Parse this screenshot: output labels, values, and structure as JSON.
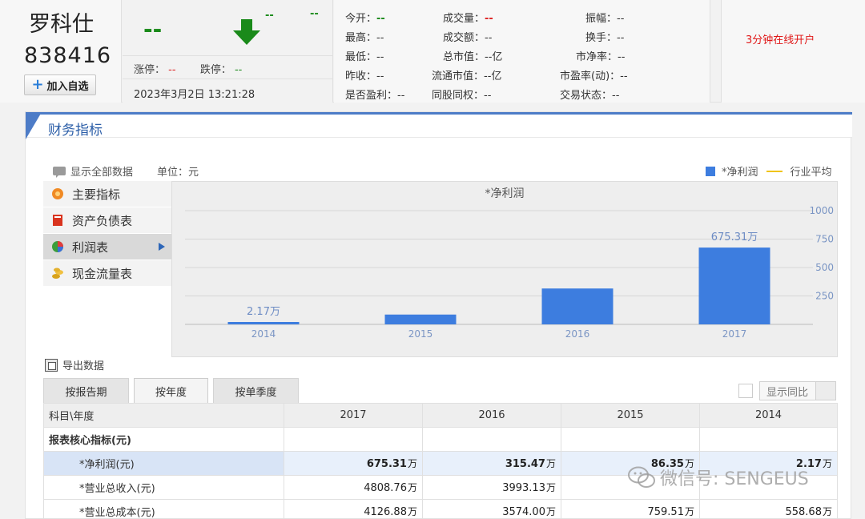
{
  "stock": {
    "name": "罗科仕",
    "code": "838416",
    "add_watchlist": "加入自选"
  },
  "price": {
    "current": "--",
    "change": "--",
    "change_pct": "--",
    "limit_up_label": "涨停：",
    "limit_up_value": "--",
    "limit_down_label": "跌停：",
    "limit_down_value": "--",
    "time": "2023年3月2日 13:21:28"
  },
  "stats": [
    {
      "label": "今开：",
      "value": "--",
      "style": "green"
    },
    {
      "label": "成交量：",
      "value": "--",
      "style": "red"
    },
    {
      "label": "振幅：",
      "value": "--",
      "style": "plain"
    },
    {
      "label": "最高：",
      "value": "--",
      "style": "plain"
    },
    {
      "label": "成交额：",
      "value": "--",
      "style": "plain"
    },
    {
      "label": "换手：",
      "value": "--",
      "style": "plain"
    },
    {
      "label": "最低：",
      "value": "--",
      "style": "plain"
    },
    {
      "label": "总市值：",
      "value": "--亿",
      "style": "plain"
    },
    {
      "label": "市净率：",
      "value": "--",
      "style": "plain"
    },
    {
      "label": "昨收：",
      "value": "--",
      "style": "plain"
    },
    {
      "label": "流通市值：",
      "value": "--亿",
      "style": "plain"
    },
    {
      "label": "市盈率(动)：",
      "value": "--",
      "style": "plain"
    },
    {
      "label": "是否盈利：",
      "value": "--",
      "style": "plain"
    },
    {
      "label": "同股同权：",
      "value": "--",
      "style": "plain"
    },
    {
      "label": "交易状态：",
      "value": "--",
      "style": "plain"
    }
  ],
  "ad": {
    "text": "3分钟在线开户"
  },
  "panel": {
    "title": "财务指标",
    "show_all": "显示全部数据",
    "unit": "单位：元",
    "legend_bar": "*净利润",
    "legend_line": "行业平均",
    "export": "导出数据"
  },
  "menu": [
    {
      "label": "主要指标",
      "icon": "gear-flower-icon"
    },
    {
      "label": "资产负债表",
      "icon": "book-icon"
    },
    {
      "label": "利润表",
      "icon": "pie-chart-icon"
    },
    {
      "label": "现金流量表",
      "icon": "coins-icon"
    }
  ],
  "tabs": [
    "按报告期",
    "按年度",
    "按单季度"
  ],
  "compare_label": "显示同比",
  "colors": {
    "bar": "#3d7ddf",
    "industry_avg": "#f0c419",
    "accent": "#4d7cc7",
    "green": "#1a8a1a",
    "red": "#dd2222"
  },
  "chart_data": {
    "type": "bar",
    "title": "*净利润",
    "categories": [
      "2014",
      "2015",
      "2016",
      "2017"
    ],
    "values": [
      2.17,
      86.35,
      315.47,
      675.31
    ],
    "data_labels": [
      "2.17万",
      "",
      "",
      "675.31万"
    ],
    "unit": "万",
    "ylim": [
      0,
      1000
    ],
    "yticks": [
      250,
      500,
      750,
      1000
    ],
    "y_axis_side": "right",
    "grid": true,
    "legend": "top-right"
  },
  "table": {
    "corner": "科目\\年度",
    "years": [
      "2017",
      "2016",
      "2015",
      "2014"
    ],
    "rows": [
      {
        "label": "报表核心指标(元)",
        "section": true,
        "values": [
          "",
          "",
          "",
          ""
        ]
      },
      {
        "label": "*净利润(元)",
        "highlight": true,
        "values": [
          "675.31",
          "315.47",
          "86.35",
          "2.17"
        ],
        "unit": "万"
      },
      {
        "label": "*营业总收入(元)",
        "values": [
          "4808.76",
          "3993.13",
          "",
          ""
        ],
        "unit": "万"
      },
      {
        "label": "*营业总成本(元)",
        "values": [
          "4126.88",
          "3574.00",
          "759.51",
          "558.68"
        ],
        "unit": "万"
      }
    ]
  },
  "watermark": "微信号: SENGEUS"
}
